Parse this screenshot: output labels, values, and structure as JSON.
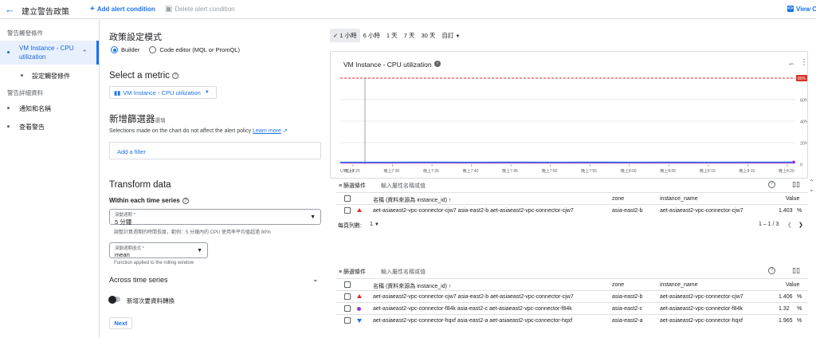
{
  "header": {
    "title": "建立警告政策",
    "add_condition": "Add alert condition",
    "delete_condition": "Delete alert condition",
    "view_code": "View C"
  },
  "nav": {
    "section1": "警告觸發條件",
    "item_condition": "VM Instance - CPU utilization",
    "item_condition_line1": "VM Instance - CPU",
    "item_condition_line2": "utilization",
    "item_trigger": "設定觸發條件",
    "section2": "警告詳細資料",
    "item_notify": "通知和名稱",
    "item_review": "查看警告"
  },
  "mode": {
    "title": "政策設定模式",
    "builder": "Builder",
    "code_editor": "Code editor (MQL or PromQL)"
  },
  "metric": {
    "title": "Select a metric",
    "value": "VM Instance - CPU utilization"
  },
  "filter": {
    "title": "新增篩選器",
    "title_suffix": "選填",
    "desc": "Selections made on the chart do not affect the alert policy",
    "learn_more": "Learn more",
    "add": "Add a filter"
  },
  "transform": {
    "title": "Transform data",
    "within": "Within each time series",
    "window_label": "滾動週期 *",
    "window_value": "5 分鐘",
    "window_hint": "調整計算週期的時間長度，範例：5 分鐘內的 CPU 使用率平均值超過 80%",
    "func_label": "滾動週期函式 *",
    "func_value": "mean",
    "func_hint": "Function applied to the rolling window",
    "across": "Across time series",
    "toggle_label": "新增次要資料轉換",
    "next": "Next"
  },
  "time_range": {
    "options": [
      "1 小時",
      "6 小時",
      "1 天",
      "7 天",
      "30 天",
      "自訂"
    ],
    "active_index": 0
  },
  "chart": {
    "title": "VM Instance - CPU utilization",
    "timezone": "UTC+8"
  },
  "chart_data": {
    "type": "line",
    "title": "VM Instance - CPU utilization",
    "x": [
      "晚上7:25",
      "晚上7:30",
      "晚上7:35",
      "晚上7:40",
      "晚上7:45",
      "晚上7:50",
      "晚上7:55",
      "晚上8:00",
      "晚上8:05",
      "晚上8:10",
      "晚上8:15",
      "晚上8:20"
    ],
    "y_ticks": [
      "0",
      "20%",
      "40%",
      "60%",
      "80%"
    ],
    "ylim": [
      0,
      80
    ],
    "threshold": 80,
    "threshold_label": "80%",
    "series": [
      {
        "name": "aet-asiaeast2-vpc-connector-cjw7",
        "color": "#d93025",
        "values": [
          1.4,
          1.4,
          1.5,
          1.4,
          1.4,
          1.4,
          1.4,
          1.4,
          1.4,
          1.4,
          1.4,
          1.4
        ]
      },
      {
        "name": "aet-asiaeast2-vpc-connector-f84k",
        "color": "#9334e6",
        "values": [
          1.3,
          1.3,
          1.3,
          1.3,
          1.3,
          1.3,
          1.3,
          1.3,
          1.3,
          1.3,
          1.3,
          1.3
        ]
      },
      {
        "name": "aet-asiaeast2-vpc-connector-hqxf",
        "color": "#1a73e8",
        "values": [
          1.9,
          1.9,
          2.0,
          1.9,
          2.0,
          1.9,
          2.0,
          1.9,
          2.0,
          1.9,
          2.0,
          2.0
        ]
      }
    ],
    "grid": true
  },
  "table1": {
    "filter": "篩選條件",
    "filter_placeholder": "輸入屬性名稱或值",
    "headers": {
      "name": "名稱 (資料來源為 instance_id)",
      "zone": "zone",
      "instance_name": "instance_name",
      "value": "Value"
    },
    "rows": [
      {
        "name": "aet-asiaeast2-vpc-connector-cjw7 asia-east2-b aet-asiaeast2-vpc-connector-cjw7",
        "zone": "asia-east2-b",
        "instance_name": "aet-asiaeast2-vpc-connector-cjw7",
        "value": "1.403",
        "unit": "%"
      }
    ],
    "rows_per_page_label": "每頁列數:",
    "rows_per_page": "1",
    "range": "1 – 1 / 3"
  },
  "table2": {
    "filter": "篩選條件",
    "filter_placeholder": "輸入屬性名稱或值",
    "headers": {
      "name": "名稱 (資料來源為 instance_id)",
      "zone": "zone",
      "instance_name": "instance_name",
      "value": "Value"
    },
    "rows": [
      {
        "name": "aet-asiaeast2-vpc-connector-cjw7 asia-east2-b aet-asiaeast2-vpc-connector-cjw7",
        "zone": "asia-east2-b",
        "instance_name": "aet-asiaeast2-vpc-connector-cjw7",
        "value": "1.406",
        "unit": "%"
      },
      {
        "name": "aet-asiaeast2-vpc-connector-f84k asia-east2-c aet-asiaeast2-vpc-connector-f84k",
        "zone": "asia-east2-c",
        "instance_name": "aet-asiaeast2-vpc-connector-f84k",
        "value": "1.32",
        "unit": "%"
      },
      {
        "name": "aet-asiaeast2-vpc-connector-hqxf asia-east2-a aet-asiaeast2-vpc-connector-hqxf",
        "zone": "asia-east2-a",
        "instance_name": "aet-asiaeast2-vpc-connector-hqxf",
        "value": "1.965",
        "unit": "%"
      }
    ]
  }
}
